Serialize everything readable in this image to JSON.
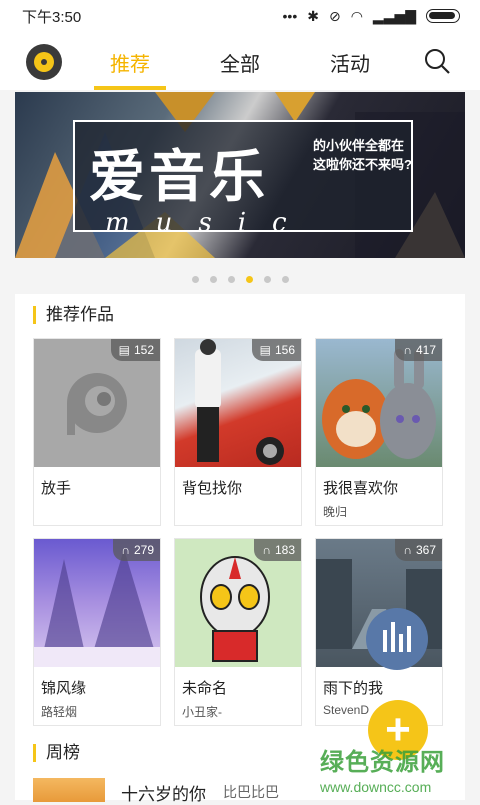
{
  "status_bar": {
    "time": "下午3:50",
    "signal_text": "...  ✱"
  },
  "nav": {
    "tabs": [
      "推荐",
      "全部",
      "活动"
    ],
    "active_tab": "推荐"
  },
  "banner": {
    "title": "爱音乐",
    "subtitle": "music",
    "side_text": "的小伙伴全都在这啦你还不来吗?"
  },
  "carousel": {
    "count": 6,
    "active_index": 3
  },
  "sections": {
    "recommend": "推荐作品",
    "weekly": "周榜"
  },
  "works": [
    {
      "title": "放手",
      "author": "",
      "count": "152",
      "icon": "lyrics-icon"
    },
    {
      "title": "背包找你",
      "author": "",
      "count": "156",
      "icon": "lyrics-icon"
    },
    {
      "title": "我很喜欢你",
      "author": "晚归",
      "count": "417",
      "icon": "headphones-icon"
    },
    {
      "title": "锦风缘",
      "author": "路轻烟",
      "count": "279",
      "icon": "headphones-icon"
    },
    {
      "title": "未命名",
      "author": "小丑家-",
      "count": "183",
      "icon": "headphones-icon"
    },
    {
      "title": "雨下的我",
      "author": "StevenD",
      "count": "367",
      "icon": "headphones-icon"
    }
  ],
  "weekly": {
    "title": "十六岁的你",
    "author": "比巴比巴"
  },
  "watermark": {
    "line1": "绿色资源网",
    "line2": "www.downcc.com"
  },
  "colors": {
    "accent": "#f5c518",
    "fab_chart": "#5878a8"
  }
}
